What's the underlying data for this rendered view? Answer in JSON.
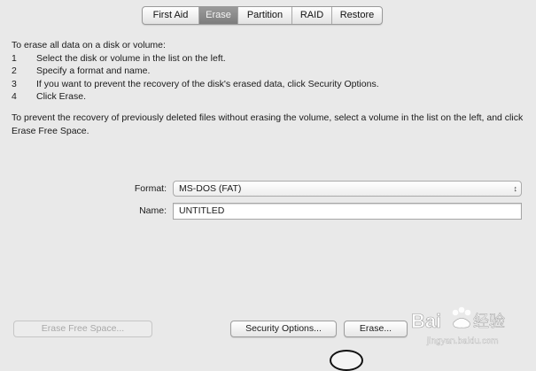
{
  "tabs": [
    {
      "label": "First Aid",
      "active": false
    },
    {
      "label": "Erase",
      "active": true
    },
    {
      "label": "Partition",
      "active": false
    },
    {
      "label": "RAID",
      "active": false
    },
    {
      "label": "Restore",
      "active": false
    }
  ],
  "instructions": {
    "intro": "To erase all data on a disk or volume:",
    "steps": [
      {
        "num": "1",
        "text": "Select the disk or volume in the list on the left."
      },
      {
        "num": "2",
        "text": "Specify a format and name."
      },
      {
        "num": "3",
        "text": "If you want to prevent the recovery of the disk's erased data, click Security Options."
      },
      {
        "num": "4",
        "text": "Click Erase."
      }
    ],
    "free_space_note": "To prevent the recovery of previously deleted files without erasing the volume, select a volume in the list on the left, and click Erase Free Space."
  },
  "form": {
    "format_label": "Format:",
    "format_value": "MS-DOS (FAT)",
    "name_label": "Name:",
    "name_value": "UNTITLED"
  },
  "buttons": {
    "erase_free_space": "Erase Free Space...",
    "security_options": "Security Options...",
    "erase": "Erase..."
  },
  "watermark": {
    "brand": "Bai",
    "brand_cn": "经验",
    "url": "jingyan.baidu.com"
  },
  "colors": {
    "window_bg": "#e9e9e9",
    "active_tab": "#8a8a8a",
    "watermark": "#ffffff"
  }
}
